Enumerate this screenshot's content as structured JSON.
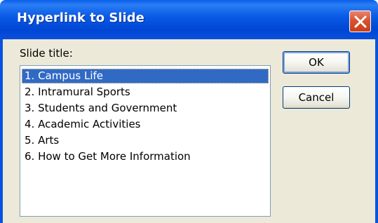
{
  "window": {
    "title": "Hyperlink to Slide"
  },
  "dialog": {
    "slide_title_label": "Slide title:",
    "slides": [
      {
        "label": "1. Campus Life",
        "selected": true
      },
      {
        "label": "2. Intramural Sports",
        "selected": false
      },
      {
        "label": "3. Students and Government",
        "selected": false
      },
      {
        "label": "4. Academic Activities",
        "selected": false
      },
      {
        "label": "5. Arts",
        "selected": false
      },
      {
        "label": "6. How to Get More Information",
        "selected": false
      }
    ],
    "ok_label": "OK",
    "cancel_label": "Cancel"
  },
  "icons": {
    "close": "close-icon"
  },
  "colors": {
    "titlebar": "#0a53e0",
    "selection": "#316ac5",
    "dialog_background": "#ece9d8",
    "close_button": "#d9532f"
  }
}
